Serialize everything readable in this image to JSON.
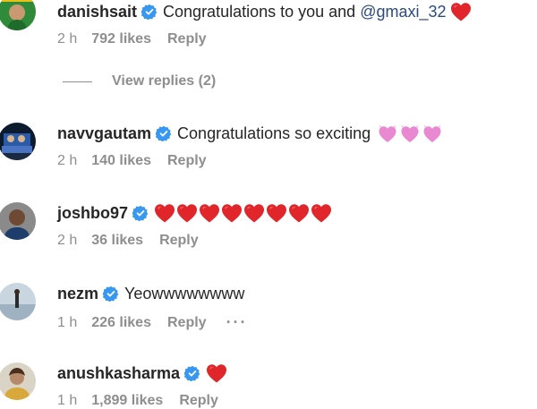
{
  "comments": [
    {
      "username": "danishsait",
      "text": "Congratulations to you and",
      "mention": "@gmaxi_32",
      "time": "2 h",
      "likes": "792 likes",
      "reply": "Reply"
    },
    {
      "username": "navvgautam",
      "text": "Congratulations so exciting",
      "time": "2 h",
      "likes": "140 likes",
      "reply": "Reply"
    },
    {
      "username": "joshbo97",
      "time": "2 h",
      "likes": "36 likes",
      "reply": "Reply"
    },
    {
      "username": "nezm",
      "text": "Yeowwwwwwww",
      "time": "1 h",
      "likes": "226 likes",
      "reply": "Reply",
      "more": "···"
    },
    {
      "username": "anushkasharma",
      "time": "1 h",
      "likes": "1,899 likes",
      "reply": "Reply"
    }
  ],
  "view_replies": "View replies (2)",
  "colors": {
    "verified": "#3897f0",
    "heart": "#e0262b",
    "pink_heart": "#e889d2",
    "mention": "#2b4a80",
    "meta": "#8e8e8e"
  }
}
